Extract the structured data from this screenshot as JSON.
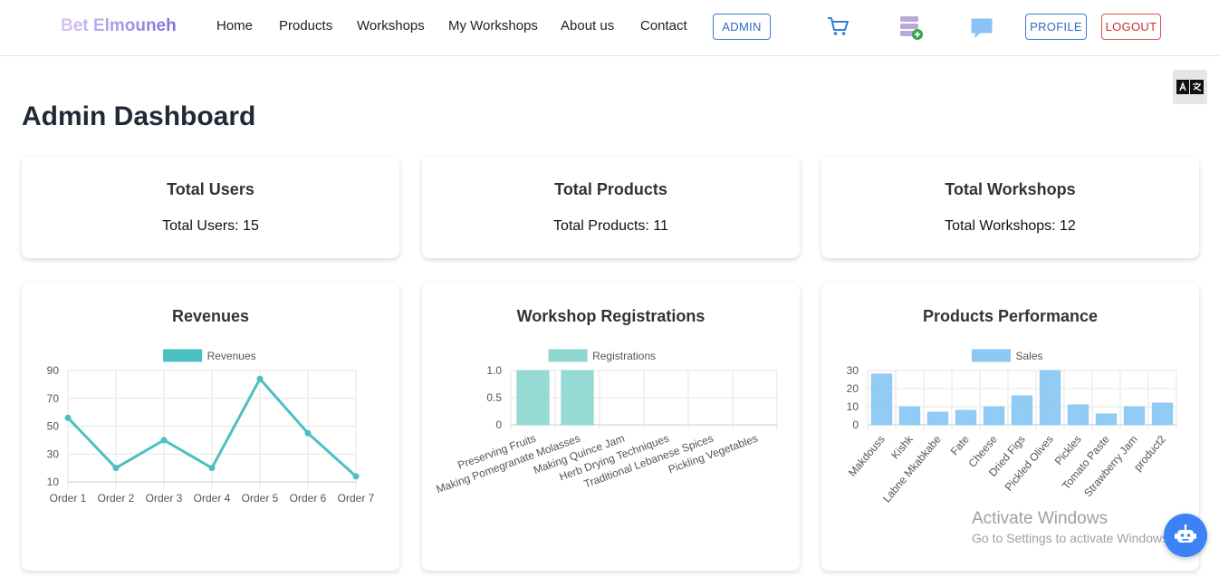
{
  "brand": "Bet Elmouneh",
  "nav": {
    "links": [
      "Home",
      "Products",
      "Workshops",
      "My Workshops",
      "About us",
      "Contact"
    ],
    "admin_label": "ADMIN",
    "profile_label": "PROFILE",
    "logout_label": "LOGOUT",
    "icons": [
      "cart-icon",
      "add-database-icon",
      "chat-icon"
    ]
  },
  "page_title": "Admin Dashboard",
  "stats": [
    {
      "title": "Total Users",
      "value": "Total Users: 15"
    },
    {
      "title": "Total Products",
      "value": "Total Products: 11"
    },
    {
      "title": "Total Workshops",
      "value": "Total Workshops: 12"
    }
  ],
  "chart_titles": [
    "Revenues",
    "Workshop Registrations",
    "Products Performance"
  ],
  "colors": {
    "revenues": "#4bc0c0",
    "registrations": "#8fd8d2",
    "sales": "#8cc8f2",
    "admin": "#2f6bbf",
    "logout": "#c9302c"
  },
  "chart_data": [
    {
      "type": "line",
      "title": "Revenues",
      "legend": [
        "Revenues"
      ],
      "categories": [
        "Order 1",
        "Order 2",
        "Order 3",
        "Order 4",
        "Order 5",
        "Order 6",
        "Order 7"
      ],
      "series": [
        {
          "name": "Revenues",
          "values": [
            56,
            20,
            40,
            20,
            84,
            45,
            14
          ]
        }
      ],
      "yticks": [
        10,
        30,
        50,
        70,
        90
      ],
      "ylim": [
        10,
        90
      ]
    },
    {
      "type": "bar",
      "title": "Workshop Registrations",
      "legend": [
        "Registrations"
      ],
      "categories": [
        "Preserving Fruits",
        "Making Pomegranate Molasses",
        "Making Quince Jam",
        "Herb Drying Techniques",
        "Traditional Lebanese Spices",
        "Pickling Vegetables"
      ],
      "series": [
        {
          "name": "Registrations",
          "values": [
            1,
            1,
            0,
            0,
            0,
            0
          ]
        }
      ],
      "yticks": [
        "0",
        "0.5",
        "1.0"
      ],
      "ylim": [
        0,
        1
      ]
    },
    {
      "type": "bar",
      "title": "Products Performance",
      "legend": [
        "Sales"
      ],
      "categories": [
        "Makdouss",
        "Kishk",
        "Labne Mkabkabe",
        "Fate",
        "Cheese",
        "Dried Figs",
        "Pickled Olives",
        "Pickles",
        "Tomato Paste",
        "Strawberry Jam",
        "product2"
      ],
      "series": [
        {
          "name": "Sales",
          "values": [
            28,
            10,
            7,
            8,
            10,
            16,
            30,
            11,
            6,
            10,
            12
          ]
        }
      ],
      "yticks": [
        0,
        10,
        20,
        30
      ],
      "ylim": [
        0,
        30
      ]
    }
  ],
  "watermark": {
    "line1": "Activate Windows",
    "line2": "Go to Settings to activate Windows."
  }
}
